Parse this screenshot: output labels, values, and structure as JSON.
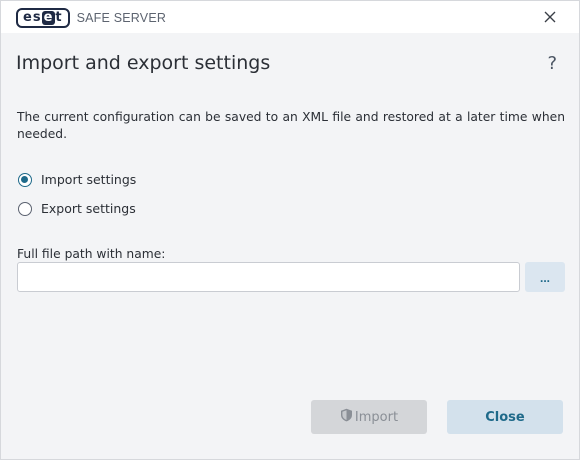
{
  "titlebar": {
    "logo_text": "eset",
    "product_name": "SAFE SERVER"
  },
  "dialog": {
    "title": "Import and export settings",
    "help_label": "?",
    "description": "The current configuration can be saved to an XML file and restored at a later time when needed.",
    "options": [
      {
        "label": "Import settings",
        "selected": true
      },
      {
        "label": "Export settings",
        "selected": false
      }
    ],
    "path_field": {
      "label": "Full file path with name:",
      "value": "",
      "placeholder": ""
    },
    "browse_label": "...",
    "import_label": "Import",
    "close_label": "Close"
  },
  "colors": {
    "accent": "#1f6a8a",
    "background": "#f3f4f6",
    "disabled_button": "#d4d6d9",
    "primary_button": "#d3e1ec"
  },
  "icons": {
    "close": "close-icon",
    "import_shield": "shield-icon"
  }
}
